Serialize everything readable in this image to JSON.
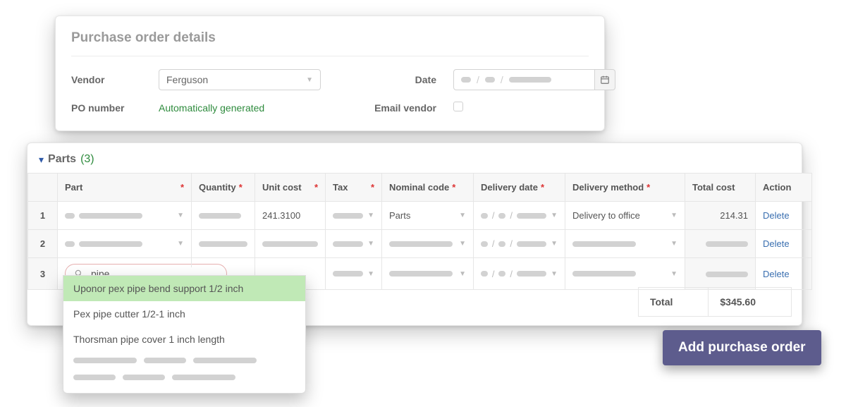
{
  "details": {
    "title": "Purchase order details",
    "vendor_label": "Vendor",
    "vendor_value": "Ferguson",
    "po_label": "PO number",
    "po_value": "Automatically generated",
    "date_label": "Date",
    "email_label": "Email vendor"
  },
  "parts": {
    "header_label": "Parts",
    "count_text": "(3)",
    "columns": {
      "part": "Part",
      "qty": "Quantity",
      "unit_cost": "Unit cost",
      "tax": "Tax",
      "nominal": "Nominal code",
      "del_date": "Delivery date",
      "del_method": "Delivery method",
      "total_cost": "Total cost",
      "action": "Action"
    },
    "rows": [
      {
        "num": "1",
        "unit_cost": "241.3100",
        "nominal": "Parts",
        "del_method": "Delivery to office",
        "total_cost": "214.31",
        "action": "Delete"
      },
      {
        "num": "2",
        "action": "Delete"
      },
      {
        "num": "3",
        "action": "Delete"
      }
    ],
    "search_value": "pipe",
    "menu": {
      "opt1": "Uponor pex pipe bend support 1/2 inch",
      "opt2": "Pex pipe cutter 1/2-1 inch",
      "opt3": "Thorsman pipe cover 1 inch length"
    },
    "total_label": "Total",
    "total_value": "$345.60"
  },
  "cta_label": "Add purchase order"
}
